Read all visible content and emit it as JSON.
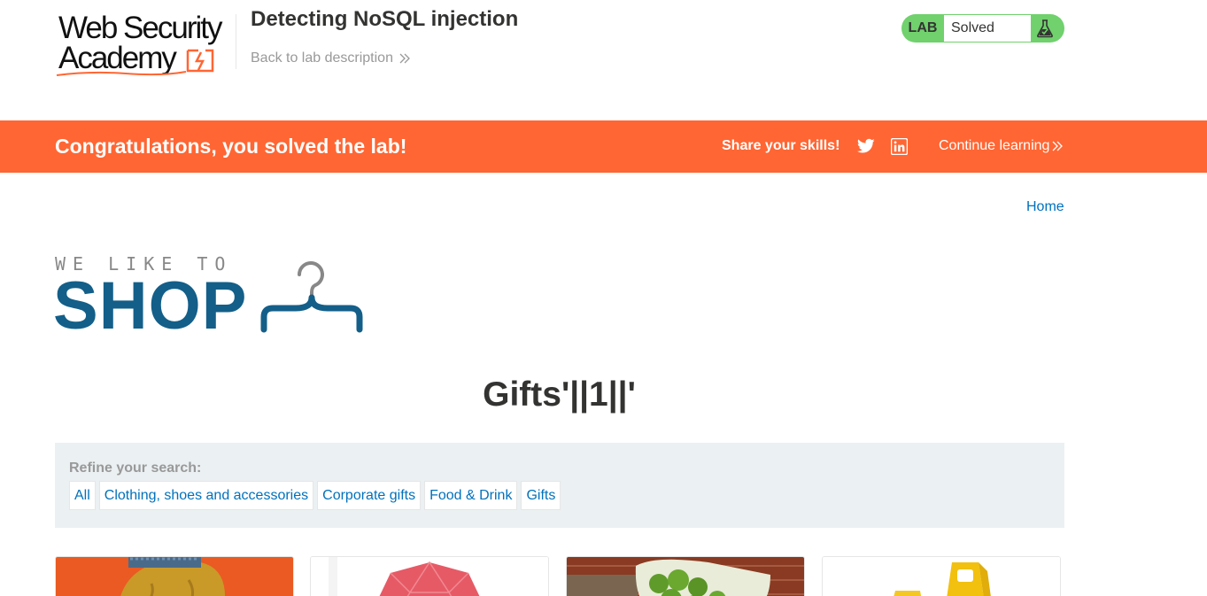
{
  "academy": {
    "logo_line1": "Web Security",
    "logo_line2": "Academy",
    "lab_title": "Detecting NoSQL injection",
    "back_link": "Back to lab description",
    "status_label": "LAB",
    "status_value": "Solved"
  },
  "banner": {
    "congrats": "Congratulations, you solved the lab!",
    "share": "Share your skills!",
    "continue": "Continue learning"
  },
  "nav": {
    "home": "Home"
  },
  "shop_logo": {
    "tagline": "WE LIKE TO",
    "word": "SHOP"
  },
  "page_heading": "Gifts'||1||'",
  "filters": {
    "label": "Refine your search:",
    "items": [
      "All",
      "Clothing, shoes and accessories",
      "Corporate gifts",
      "Food & Drink",
      "Gifts"
    ]
  },
  "colors": {
    "brand_orange": "#ff6633",
    "solved_green": "#70d16d",
    "link_blue": "#0071bc",
    "shop_blue": "#135f89",
    "panel_grey": "#ebf0f2"
  },
  "icons": {
    "back": "double-chevron-right-icon",
    "status": "flask-icon",
    "social": [
      "twitter-icon",
      "linkedin-icon"
    ],
    "continue": "double-chevron-right-icon",
    "logo": "hanger-icon"
  }
}
